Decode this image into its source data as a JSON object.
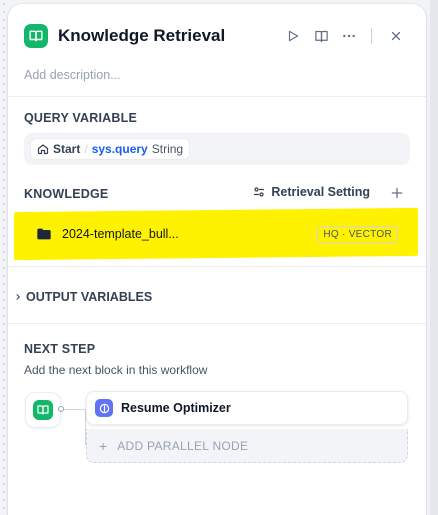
{
  "node": {
    "title": "Knowledge Retrieval",
    "description_placeholder": "Add description..."
  },
  "icons": {
    "node_type": "book-open-icon",
    "run": "play-icon",
    "panel": "book-icon",
    "more": "more-horizontal-icon",
    "close": "close-icon",
    "home": "home-icon",
    "settings": "sliders-icon",
    "add": "plus-icon",
    "folder": "folder-icon",
    "chevron": "chevron-right-icon",
    "next_node": "resume-optimizer-icon"
  },
  "query_variable": {
    "label": "QUERY VARIABLE",
    "source": "Start",
    "separator": "/",
    "variable": "sys.query",
    "type": "String"
  },
  "knowledge": {
    "label": "KNOWLEDGE",
    "retrieval_setting": "Retrieval Setting",
    "items": [
      {
        "name": "2024-template_bull...",
        "badge": "HQ · VECTOR"
      }
    ]
  },
  "output_variables": {
    "label": "OUTPUT VARIABLES"
  },
  "next_step": {
    "label": "NEXT STEP",
    "subtitle": "Add the next block in this workflow",
    "next_node": "Resume Optimizer",
    "add_parallel": "ADD PARALLEL NODE"
  },
  "colors": {
    "node_icon": "#12b76a",
    "highlight": "#fff200",
    "variable": "#155eef",
    "next_node_icon": "#6172f3"
  }
}
